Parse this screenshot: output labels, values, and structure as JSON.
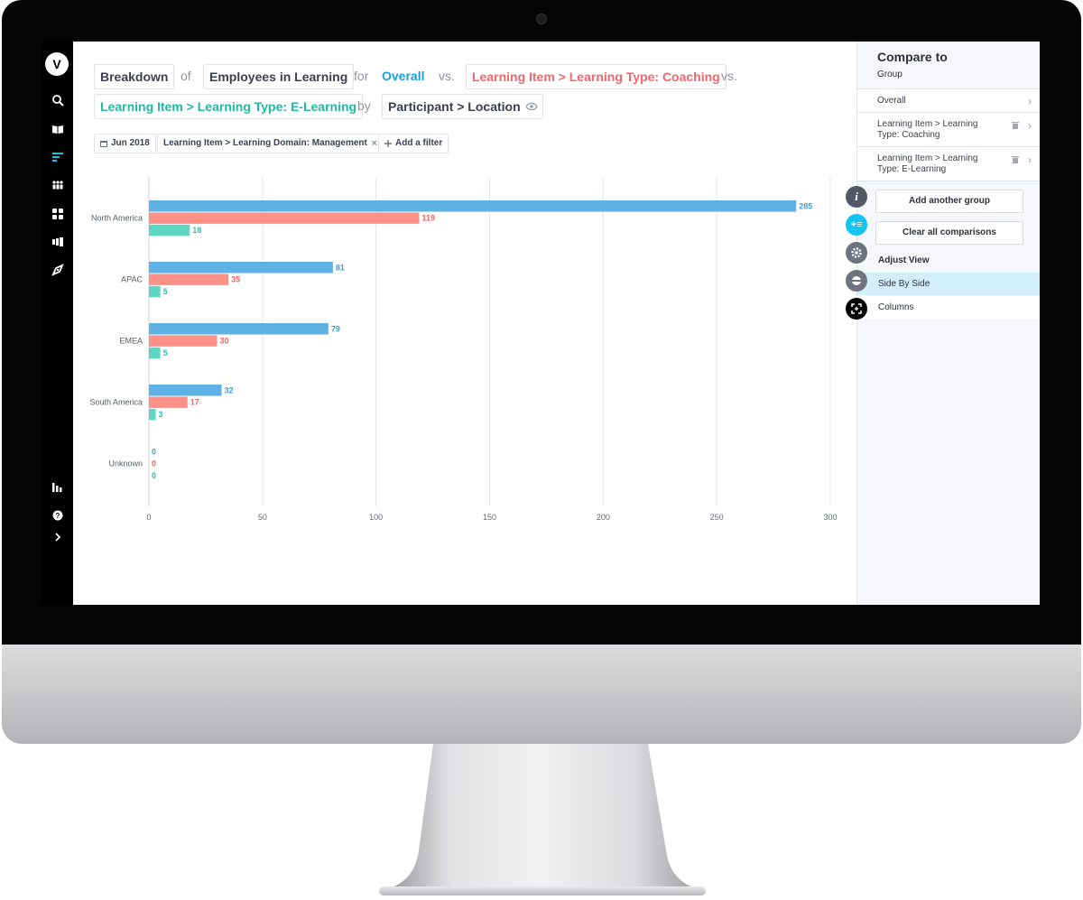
{
  "app": {
    "logo_letter": "V"
  },
  "sidebar": {
    "icons": [
      "search-icon",
      "book-icon",
      "breakdown-icon",
      "people-icon",
      "grid-icon",
      "compare-icon",
      "explore-icon",
      "bar-chart-icon",
      "help-icon",
      "expand-icon"
    ]
  },
  "query": {
    "metric_prefix": "Breakdown",
    "of_word": "of",
    "metric": "Employees in Learning",
    "for_word": "for",
    "group_overall": "Overall",
    "vs_word_1": "vs.",
    "group_coaching": "Learning Item > Learning Type: Coaching",
    "vs_word_2": "vs.",
    "group_elearning": "Learning Item > Learning Type: E-Learning",
    "by_word": "by",
    "dimension": "Participant > Location"
  },
  "filters": {
    "date": "Jun 2018",
    "domain": "Learning Item > Learning Domain: Management",
    "remove_symbol": "×",
    "add_filter": "Add a filter"
  },
  "chart_data": {
    "type": "bar",
    "orientation": "horizontal",
    "categories": [
      "North America",
      "APAC",
      "EMEA",
      "South America",
      "Unknown"
    ],
    "series": [
      {
        "values": [
          285,
          81,
          79,
          32,
          0
        ],
        "color": "#5db1e3"
      },
      {
        "values": [
          119,
          35,
          30,
          17,
          0
        ],
        "color": "#fb9187"
      },
      {
        "values": [
          18,
          5,
          5,
          3,
          0
        ],
        "color": "#5fd5c4"
      }
    ],
    "x_ticks": [
      0,
      50,
      100,
      150,
      200,
      250,
      300
    ],
    "xlim": [
      0,
      300
    ],
    "grid": true,
    "value_label_colors": [
      "#3a9edb",
      "#f0665e",
      "#2fbfae"
    ]
  },
  "panel": {
    "title": "Compare to",
    "subtitle": "Group",
    "rows": [
      {
        "label": "Overall"
      },
      {
        "label_line1": "Learning Item > Learning",
        "label_line2": "Type: Coaching"
      },
      {
        "label_line1": "Learning Item > Learning",
        "label_line2": "Type: E-Learning"
      }
    ],
    "add_group": "Add another group",
    "clear_all": "Clear all comparisons",
    "adjust_view": "Adjust View",
    "view_options": [
      "Side By Side",
      "Columns"
    ],
    "selected_view": "Side By Side",
    "highlight_color": "#d3effc"
  },
  "fabs": {
    "info": "i",
    "add": "+≡"
  }
}
